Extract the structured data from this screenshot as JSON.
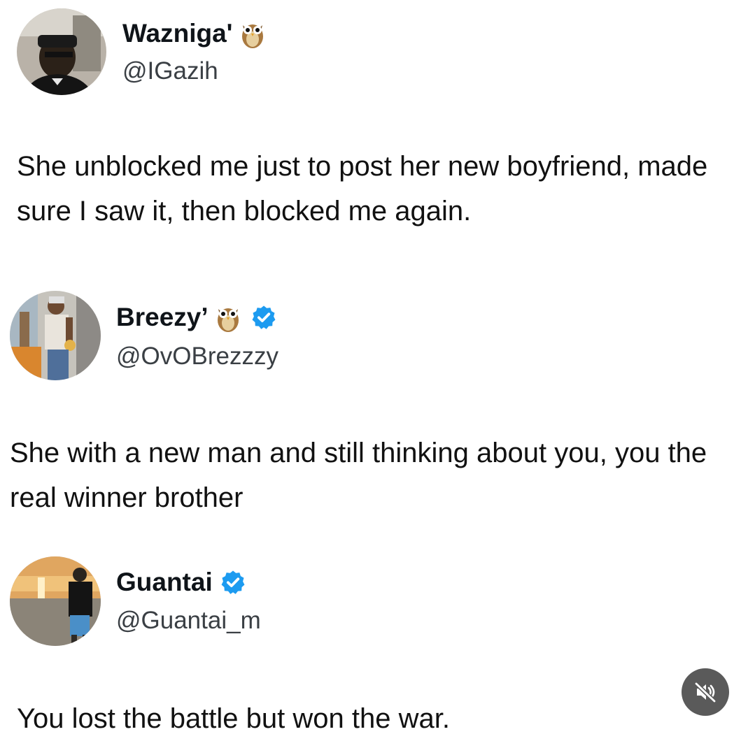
{
  "tweets": [
    {
      "display_name": "Wazniga'",
      "handle": "@IGazih",
      "emoji": "owl-emoji",
      "verified": false,
      "text": "She unblocked me just to post her new boyfriend, made sure I saw it, then blocked me again."
    },
    {
      "display_name": "Breezy’",
      "handle": "@OvOBrezzzy",
      "emoji": "owl-emoji",
      "verified": true,
      "text": "She with a new man and still thinking about you, you the real winner brother"
    },
    {
      "display_name": "Guantai",
      "handle": "@Guantai_m",
      "verified": true,
      "text": "You lost the battle but won the war."
    }
  ],
  "mute_button": {
    "icon": "speaker-muted-icon",
    "state": "muted"
  },
  "colors": {
    "verified_blue": "#1d9bf0",
    "text": "#0f1419",
    "handle": "#3a3f44",
    "mute_bg": "#5a5a5a"
  }
}
